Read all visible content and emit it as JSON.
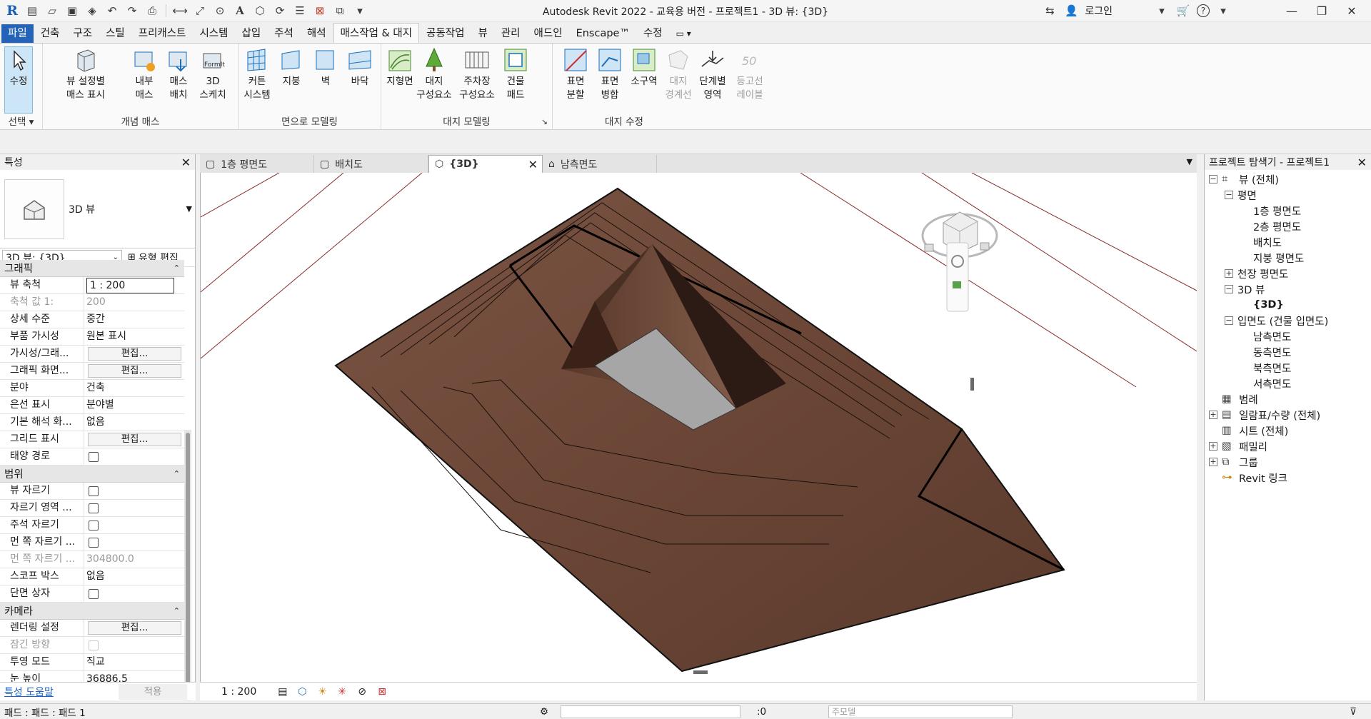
{
  "titlebar": {
    "title": "Autodesk Revit 2022 - 교육용 버전 - 프로젝트1 - 3D 뷰: {3D}",
    "login_label": "로그인"
  },
  "tabs": [
    "파일",
    "건축",
    "구조",
    "스틸",
    "프리캐스트",
    "시스템",
    "삽입",
    "주석",
    "해석",
    "매스작업 & 대지",
    "공동작업",
    "뷰",
    "관리",
    "애드인",
    "Enscape™",
    "수정"
  ],
  "ribbon": {
    "select": {
      "label": "수정",
      "dropdown": "선택"
    },
    "conceptual_mass": {
      "label": "개념 매스",
      "buttons": [
        "뷰 설정별\n매스 표시",
        "내부\n매스",
        "매스\n배치",
        "3D\n스케치"
      ]
    },
    "model_by_face": {
      "label": "면으로 모델링",
      "buttons": [
        "커튼\n시스템",
        "지붕",
        "벽",
        "바닥"
      ]
    },
    "site_modeling": {
      "label": "대지 모델링",
      "buttons": [
        "지형면",
        "대지\n구성요소",
        "주차장\n구성요소",
        "건물\n패드"
      ]
    },
    "modify_site": {
      "label": "대지 수정",
      "buttons": [
        "표면\n분할",
        "표면\n병합",
        "소구역",
        "대지\n경계선",
        "단계별\n영역",
        "등고선\n레이블"
      ]
    }
  },
  "properties": {
    "title": "특성",
    "type_name": "3D 뷰",
    "instance_selector": "3D 뷰: {3D}",
    "edit_type": "유형 편집",
    "categories": [
      {
        "name": "그래픽",
        "rows": [
          {
            "name": "뷰 축척",
            "value": "1 : 200",
            "kind": "input"
          },
          {
            "name": "축척 값    1:",
            "value": "200",
            "kind": "dim"
          },
          {
            "name": "상세 수준",
            "value": "중간",
            "kind": "text"
          },
          {
            "name": "부품 가시성",
            "value": "원본 표시",
            "kind": "text"
          },
          {
            "name": "가시성/그래...",
            "value": "편집...",
            "kind": "button"
          },
          {
            "name": "그래픽 화면...",
            "value": "편집...",
            "kind": "button"
          },
          {
            "name": "분야",
            "value": "건축",
            "kind": "text"
          },
          {
            "name": "은선 표시",
            "value": "분야별",
            "kind": "text"
          },
          {
            "name": "기본 해석 화...",
            "value": "없음",
            "kind": "text"
          },
          {
            "name": "그리드 표시",
            "value": "편집...",
            "kind": "button"
          },
          {
            "name": "태양 경로",
            "value": "",
            "kind": "check"
          }
        ]
      },
      {
        "name": "범위",
        "rows": [
          {
            "name": "뷰 자르기",
            "value": "",
            "kind": "check"
          },
          {
            "name": "자르기 영역 ...",
            "value": "",
            "kind": "check"
          },
          {
            "name": "주석 자르기",
            "value": "",
            "kind": "check"
          },
          {
            "name": "먼 쪽 자르기 ...",
            "value": "",
            "kind": "check"
          },
          {
            "name": "먼 쪽 자르기 ...",
            "value": "304800.0",
            "kind": "dim"
          },
          {
            "name": "스코프 박스",
            "value": "없음",
            "kind": "text"
          },
          {
            "name": "단면 상자",
            "value": "",
            "kind": "check"
          }
        ]
      },
      {
        "name": "카메라",
        "rows": [
          {
            "name": "렌더링 설정",
            "value": "편집...",
            "kind": "button"
          },
          {
            "name": "잠긴 방향",
            "value": "",
            "kind": "checkdim"
          },
          {
            "name": "투영 모드",
            "value": "직교",
            "kind": "text"
          },
          {
            "name": "눈 높이",
            "value": "36886.5",
            "kind": "text"
          }
        ]
      }
    ],
    "help_link": "특성 도움말",
    "apply": "적용"
  },
  "view_tabs": [
    {
      "label": "1층 평면도",
      "active": false
    },
    {
      "label": "배치도",
      "active": false
    },
    {
      "label": "{3D}",
      "active": true
    },
    {
      "label": "남측면도",
      "active": false
    }
  ],
  "view_control": {
    "scale": "1 : 200"
  },
  "browser": {
    "title": "프로젝트 탐색기 - 프로젝트1",
    "items": [
      {
        "label": "뷰 (전체)",
        "level": 0,
        "toggle": "−",
        "icon": "views"
      },
      {
        "label": "평면",
        "level": 1,
        "toggle": "−",
        "icon": ""
      },
      {
        "label": "1층 평면도",
        "level": 2,
        "toggle": "",
        "icon": ""
      },
      {
        "label": "2층 평면도",
        "level": 2,
        "toggle": "",
        "icon": ""
      },
      {
        "label": "배치도",
        "level": 2,
        "toggle": "",
        "icon": ""
      },
      {
        "label": "지붕 평면도",
        "level": 2,
        "toggle": "",
        "icon": ""
      },
      {
        "label": "천장 평면도",
        "level": 1,
        "toggle": "+",
        "icon": ""
      },
      {
        "label": "3D 뷰",
        "level": 1,
        "toggle": "−",
        "icon": ""
      },
      {
        "label": "{3D}",
        "level": 2,
        "toggle": "",
        "icon": "",
        "bold": true
      },
      {
        "label": "입면도 (건물 입면도)",
        "level": 1,
        "toggle": "−",
        "icon": ""
      },
      {
        "label": "남측면도",
        "level": 2,
        "toggle": "",
        "icon": ""
      },
      {
        "label": "동측면도",
        "level": 2,
        "toggle": "",
        "icon": ""
      },
      {
        "label": "북측면도",
        "level": 2,
        "toggle": "",
        "icon": ""
      },
      {
        "label": "서측면도",
        "level": 2,
        "toggle": "",
        "icon": ""
      },
      {
        "label": "범례",
        "level": 0,
        "toggle": "",
        "icon": "legend"
      },
      {
        "label": "일람표/수량 (전체)",
        "level": 0,
        "toggle": "+",
        "icon": "schedule"
      },
      {
        "label": "시트 (전체)",
        "level": 0,
        "toggle": "",
        "icon": "sheet"
      },
      {
        "label": "패밀리",
        "level": 0,
        "toggle": "+",
        "icon": "family"
      },
      {
        "label": "그룹",
        "level": 0,
        "toggle": "+",
        "icon": "group"
      },
      {
        "label": "Revit 링크",
        "level": 0,
        "toggle": "",
        "icon": "link"
      }
    ]
  },
  "status": {
    "left": "패드 : 패드 : 패드 1",
    "filter_placeholder": "주모델",
    "filter_count": ":0"
  },
  "colors": {
    "terrain": "#6f4a39",
    "terrain_dark": "#3d271f",
    "pad": "#a6a6a6",
    "file_tab": "#2563b8"
  }
}
